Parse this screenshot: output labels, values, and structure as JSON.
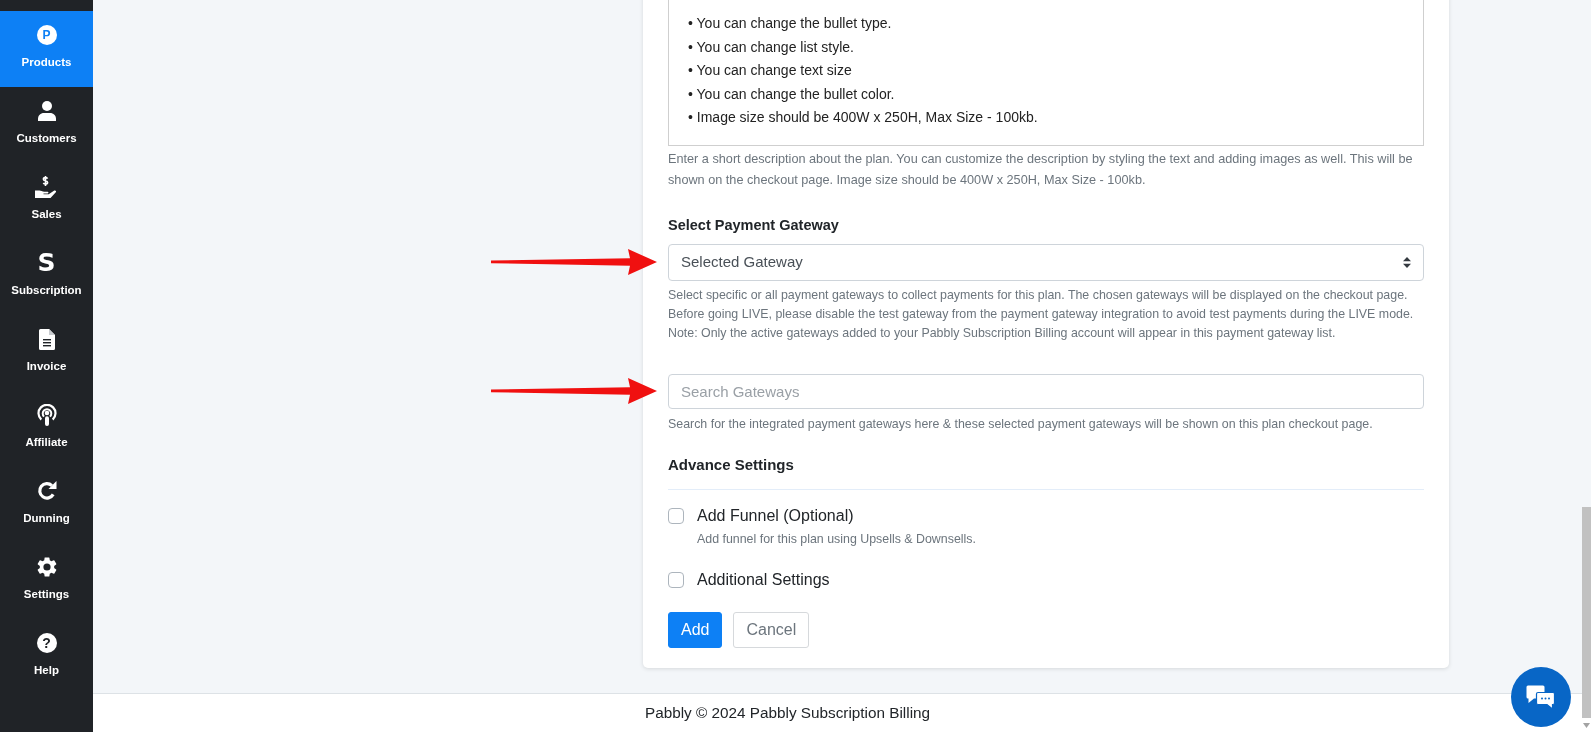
{
  "sidebar": {
    "items": [
      {
        "label": "Products",
        "kind": "badge",
        "glyph": "P",
        "selected": true
      },
      {
        "label": "Customers",
        "kind": "icon",
        "selected": false
      },
      {
        "label": "Sales",
        "kind": "icon",
        "selected": false
      },
      {
        "label": "Subscription",
        "kind": "letter",
        "glyph": "S",
        "selected": false
      },
      {
        "label": "Invoice",
        "kind": "icon",
        "selected": false
      },
      {
        "label": "Affiliate",
        "kind": "icon",
        "selected": false
      },
      {
        "label": "Dunning",
        "kind": "icon",
        "selected": false
      },
      {
        "label": "Settings",
        "kind": "icon",
        "selected": false
      },
      {
        "label": "Help",
        "kind": "help",
        "glyph": "?",
        "selected": false
      }
    ]
  },
  "description_editor": {
    "lines": [
      "• You can change the bullet type.",
      "• You can change list style.",
      "• You can change text size",
      "• You can change the bullet color.",
      "• Image size should be 400W x 250H, Max Size - 100kb."
    ],
    "help": "Enter a short description about the plan. You can customize the description by styling the text and adding images as well. This will be shown on the checkout page. Image size should be 400W x 250H, Max Size - 100kb."
  },
  "payment_gateway": {
    "label": "Select Payment Gateway",
    "select": {
      "value": "Selected Gateway",
      "arrow": true
    },
    "help": "Select specific or all payment gateways to collect payments for this plan. The chosen gateways will be displayed on the checkout page. Before going LIVE, please disable the test gateway from the payment gateway integration to avoid test payments during the LIVE mode.",
    "note": "Note: Only the active gateways added to your Pabbly Subscription Billing account will appear in this payment gateway list."
  },
  "gateway_search": {
    "placeholder": "Search Gateways",
    "arrow": true,
    "help": "Search for the integrated payment gateways here & these selected payment gateways will be shown on this plan checkout page."
  },
  "advance_settings": {
    "title": "Advance Settings",
    "options": [
      {
        "label": "Add Funnel (Optional)",
        "checked": false,
        "help": "Add funnel for this plan using Upsells & Downsells."
      },
      {
        "label": "Additional Settings",
        "checked": false
      }
    ]
  },
  "buttons": [
    {
      "label": "Add",
      "kind": "primary"
    },
    {
      "label": "Cancel",
      "kind": "secondary"
    }
  ],
  "footer": {
    "text": "Pabbly © 2024 Pabbly Subscription Billing"
  }
}
